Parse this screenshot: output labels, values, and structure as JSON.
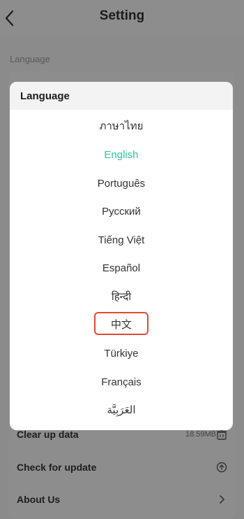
{
  "header": {
    "title": "Setting"
  },
  "section": {
    "label": "Language"
  },
  "background_rows": [
    {
      "label": "Clear up data",
      "value": "18.59MB",
      "icon": "trash-icon"
    },
    {
      "label": "Check for update",
      "icon": "arrow-up-circle-icon"
    },
    {
      "label": "About Us",
      "icon": "chevron-right-icon"
    }
  ],
  "dialog": {
    "title": "Language",
    "options": [
      "ภาษาไทย",
      "English",
      "Português",
      "Русский",
      "Tiếng Việt",
      "Español",
      "हिन्दी",
      "中文",
      "Türkiye",
      "Français",
      "العَرَبِيَّة"
    ],
    "selected": "English",
    "highlighted": "中文"
  },
  "colors": {
    "accent": "#2fc4a0",
    "highlight_border": "#e04a31",
    "overlay": "#8b8b8b",
    "dialog_background": "#ffffff"
  }
}
